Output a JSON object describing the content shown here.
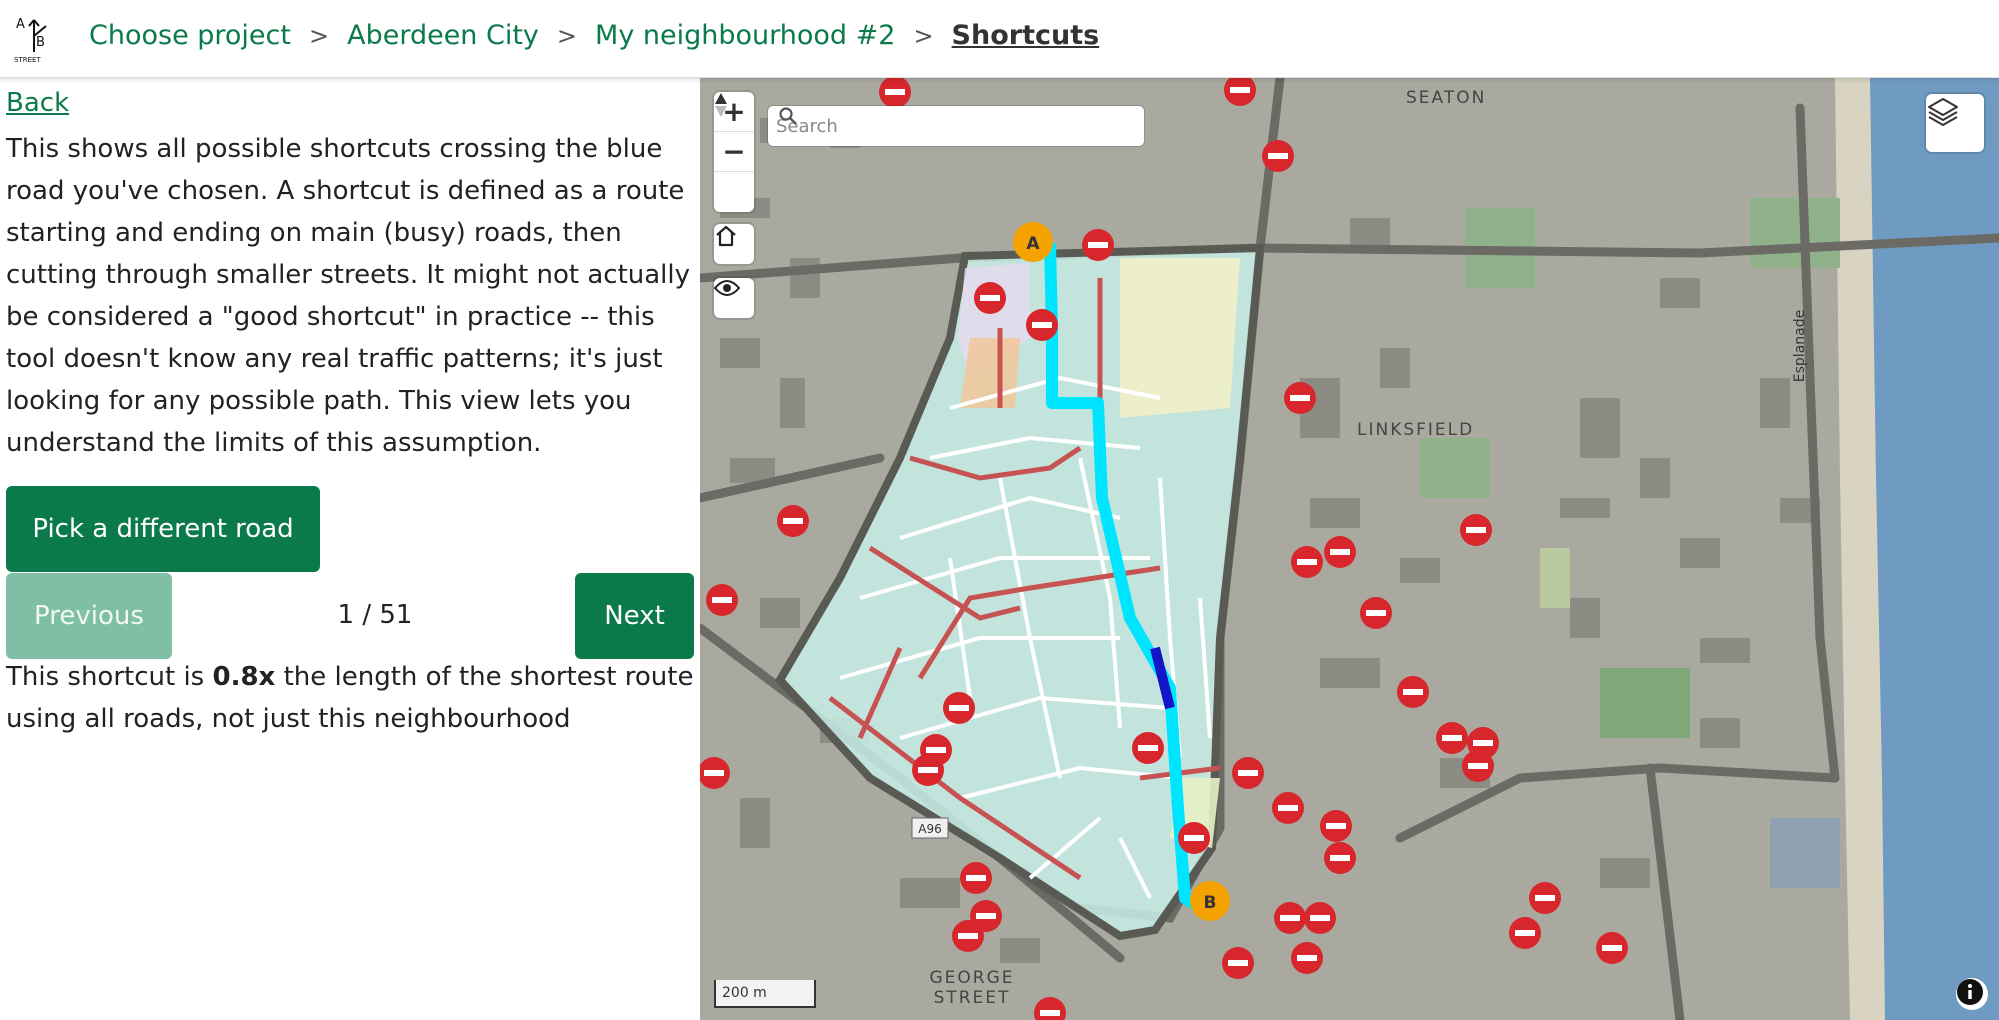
{
  "header": {
    "logo_lines": [
      "A",
      "B",
      "STREET"
    ],
    "breadcrumbs": [
      "Choose project",
      "Aberdeen City",
      "My neighbourhood #2"
    ],
    "separator": ">",
    "current": "Shortcuts"
  },
  "sidebar": {
    "back_label": "Back",
    "description": "This shows all possible shortcuts crossing the blue road you've chosen. A shortcut is defined as a route starting and ending on main (busy) roads, then cutting through smaller streets. It might not actually be considered a \"good shortcut\" in practice -- this tool doesn't know any real traffic patterns; it's just looking for any possible path. This view lets you understand the limits of this assumption.",
    "pick_button": "Pick a different road",
    "prev_button": "Previous",
    "next_button": "Next",
    "counter": "1 / 51",
    "result_prefix": "This shortcut is ",
    "result_ratio": "0.8x",
    "result_suffix": " the length of the shortest route using all roads, not just this neighbourhood"
  },
  "map": {
    "search_placeholder": "Search",
    "zoom_in": "+",
    "zoom_out": "−",
    "scale_label": "200 m",
    "marker_a": "A",
    "marker_b": "B",
    "labels": {
      "seaton": "SEATON",
      "linksfield": "LINKSFIELD",
      "george_street": "GEORGE STREET",
      "esplanade": "Esplanade",
      "a96": "A96"
    },
    "colors": {
      "primary": "#0b7a4b",
      "route": "#00e5ff",
      "chosen_road": "#1414c8",
      "marker": "#f5a300",
      "neighbourhood": "#c8efe8",
      "sea": "#6f9bc2"
    }
  }
}
